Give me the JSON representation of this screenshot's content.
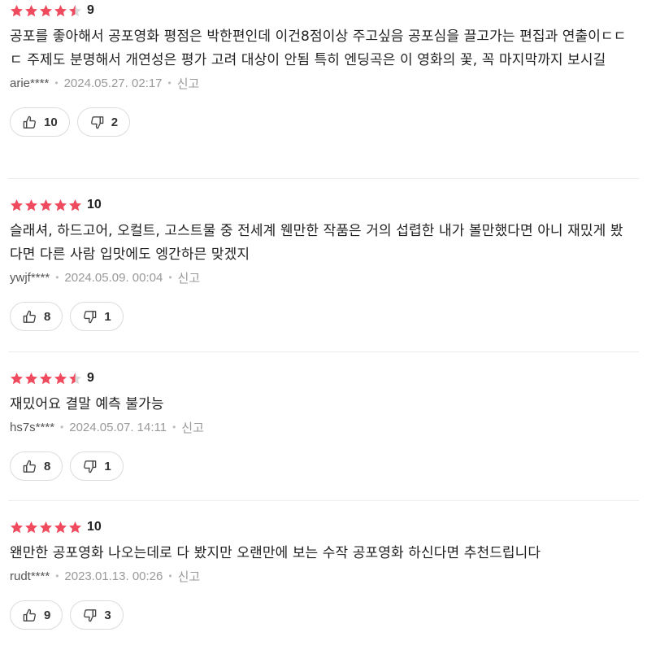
{
  "colors": {
    "star_filled": "#f04a5e",
    "star_empty": "#d9d9d9"
  },
  "reviews": [
    {
      "score": "9",
      "stars": 4.5,
      "text": "공포를 좋아해서 공포영화 평점은 박한편인데 이건8점이상 주고싶음 공포심을 끌고가는 편집과 연출이ㄷㄷㄷ 주제도 분명해서 개연성은 평가 고려 대상이 안됨 특히 엔딩곡은 이 영화의 꽃, 꼭 마지막까지 보시길",
      "user": "arie****",
      "date": "2024.05.27. 02:17",
      "report": "신고",
      "likes": "10",
      "dislikes": "2"
    },
    {
      "score": "10",
      "stars": 5,
      "text": "슬래셔, 하드고어, 오컬트, 고스트물 중 전세계 웬만한 작품은 거의 섭렵한 내가 볼만했다면 아니 재밌게 봤다면 다른 사람 입맛에도 엥간하믄 맞겠지",
      "user": "ywjf****",
      "date": "2024.05.09. 00:04",
      "report": "신고",
      "likes": "8",
      "dislikes": "1"
    },
    {
      "score": "9",
      "stars": 4.5,
      "text": "재밌어요 결말 예측 불가능",
      "user": "hs7s****",
      "date": "2024.05.07. 14:11",
      "report": "신고",
      "likes": "8",
      "dislikes": "1"
    },
    {
      "score": "10",
      "stars": 5,
      "text": "왠만한 공포영화 나오는데로 다 봤지만 오랜만에 보는 수작 공포영화 하신다면 추천드립니다",
      "user": "rudt****",
      "date": "2023.01.13. 00:26",
      "report": "신고",
      "likes": "9",
      "dislikes": "3"
    }
  ]
}
